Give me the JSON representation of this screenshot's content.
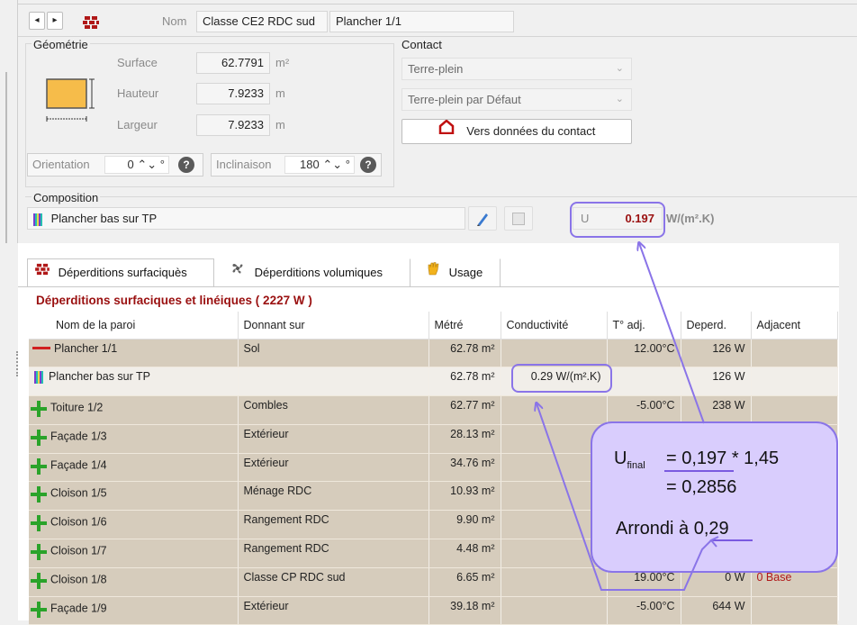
{
  "header": {
    "nav_prev": "◂",
    "nav_next": "▸",
    "nom_label": "Nom",
    "nom_value": "Classe CE2 RDC sud",
    "wall_name": "Plancher 1/1"
  },
  "geometrie": {
    "title": "Géométrie",
    "surface_label": "Surface",
    "surface_value": "62.7791",
    "surface_unit": "m²",
    "hauteur_label": "Hauteur",
    "hauteur_value": "7.9233",
    "hauteur_unit": "m",
    "largeur_label": "Largeur",
    "largeur_value": "7.9233",
    "largeur_unit": "m",
    "orientation_label": "Orientation",
    "orientation_value": "0",
    "inclinaison_label": "Inclinaison",
    "inclinaison_value": "180",
    "degree": "°"
  },
  "contact": {
    "title": "Contact",
    "type_value": "Terre-plein",
    "preset_value": "Terre-plein par Défaut",
    "button_label": "Vers données du contact"
  },
  "composition": {
    "title": "Composition",
    "value": "Plancher bas sur TP",
    "u_label": "U",
    "u_value": "0.197",
    "u_unit": "W/(m².K)"
  },
  "tabs": [
    {
      "label": "Déperditions surfaciquès"
    },
    {
      "label": "Déperditions volumiques"
    },
    {
      "label": "Usage"
    }
  ],
  "section_title": "Déperditions surfaciques et linéiques ( 2227 W )",
  "table": {
    "columns": [
      "Nom de la paroi",
      "Donnant sur",
      "Métré",
      "Conductivité",
      "T° adj.",
      "Deperd.",
      "Adjacent"
    ],
    "rows": [
      {
        "icon": "red-line",
        "name": "Plancher 1/1",
        "donnant": "Sol",
        "metre": "62.78 m²",
        "cond": "",
        "tadj": "12.00°C",
        "deperd": "126 W",
        "adj": ""
      },
      {
        "icon": "composition",
        "name": "Plancher bas sur TP",
        "donnant": "",
        "metre": "62.78 m²",
        "cond": "0.29 W/(m².K)",
        "tadj": "",
        "deperd": "126 W",
        "adj": ""
      },
      {
        "icon": "plus",
        "name": "Toiture 1/2",
        "donnant": "Combles",
        "metre": "62.77 m²",
        "cond": "",
        "tadj": "-5.00°C",
        "deperd": "238 W",
        "adj": ""
      },
      {
        "icon": "plus",
        "name": "Façade 1/3",
        "donnant": "Extérieur",
        "metre": "28.13 m²",
        "cond": "",
        "tadj": "",
        "deperd": "",
        "adj": ""
      },
      {
        "icon": "plus",
        "name": "Façade 1/4",
        "donnant": "Extérieur",
        "metre": "34.76 m²",
        "cond": "",
        "tadj": "",
        "deperd": "",
        "adj": ""
      },
      {
        "icon": "plus",
        "name": "Cloison 1/5",
        "donnant": "Ménage RDC",
        "metre": "10.93 m²",
        "cond": "",
        "tadj": "",
        "deperd": "",
        "adj": ""
      },
      {
        "icon": "plus",
        "name": "Cloison 1/6",
        "donnant": "Rangement RDC",
        "metre": "9.90 m²",
        "cond": "",
        "tadj": "",
        "deperd": "",
        "adj": ""
      },
      {
        "icon": "plus",
        "name": "Cloison 1/7",
        "donnant": "Rangement RDC",
        "metre": "4.48 m²",
        "cond": "",
        "tadj": "",
        "deperd": "",
        "adj": ""
      },
      {
        "icon": "plus",
        "name": "Cloison 1/8",
        "donnant": "Classe CP RDC sud",
        "metre": "6.65 m²",
        "cond": "",
        "tadj": "19.00°C",
        "deperd": "0 W",
        "adj": "0 Base"
      },
      {
        "icon": "plus",
        "name": "Façade 1/9",
        "donnant": "Extérieur",
        "metre": "39.18 m²",
        "cond": "",
        "tadj": "-5.00°C",
        "deperd": "644 W",
        "adj": ""
      }
    ]
  },
  "annotation": {
    "u_letter": "U",
    "u_subscript": "final",
    "line1": "= 0,197 * 1,45",
    "line2": "= 0,2856",
    "line3": "Arrondi à 0,29"
  },
  "colors": {
    "accent": "#8a74e8",
    "bubble_fill": "#d9cdfd",
    "dark_red": "#9a1010",
    "row_odd": "#d6ccbc",
    "row_even": "#f1eee9"
  }
}
